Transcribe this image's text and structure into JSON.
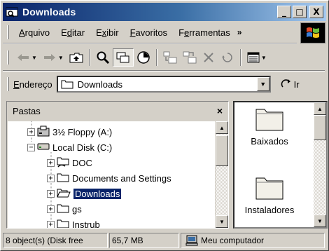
{
  "window": {
    "title": "Downloads",
    "caption_buttons": {
      "minimize": "_",
      "maximize": "□",
      "close": "X"
    }
  },
  "menubar": {
    "items": [
      {
        "label": "Arquivo",
        "accel_index": 0
      },
      {
        "label": "Editar",
        "accel_index": 1
      },
      {
        "label": "Exibir",
        "accel_index": 1
      },
      {
        "label": "Favoritos",
        "accel_index": 0
      },
      {
        "label": "Ferramentas",
        "accel_index": 1
      }
    ],
    "overflow": "»"
  },
  "toolbar": {
    "buttons": [
      {
        "name": "back-icon",
        "dropdown": true
      },
      {
        "name": "forward-icon",
        "dropdown": true
      },
      {
        "name": "up-folder-icon"
      },
      {
        "name": "search-icon"
      },
      {
        "name": "folders-icon",
        "pressed": true
      },
      {
        "name": "history-icon"
      },
      {
        "name": "move-to-icon"
      },
      {
        "name": "copy-to-icon"
      },
      {
        "name": "delete-icon"
      },
      {
        "name": "undo-icon"
      },
      {
        "name": "views-icon",
        "dropdown": true
      }
    ]
  },
  "address": {
    "label": "Endereço",
    "value": "Downloads",
    "go_label": "Ir"
  },
  "folders_pane": {
    "title": "Pastas",
    "close": "×",
    "tree": [
      {
        "label": "3½ Floppy (A:)",
        "icon": "floppy-drive-icon",
        "expander": "+",
        "level": 1
      },
      {
        "label": "Local Disk (C:)",
        "icon": "hard-drive-icon",
        "expander": "−",
        "level": 1
      },
      {
        "label": "DOC",
        "icon": "shared-folder-icon",
        "expander": "+",
        "level": 2
      },
      {
        "label": "Documents and Settings",
        "icon": "folder-icon",
        "expander": "+",
        "level": 2
      },
      {
        "label": "Downloads",
        "icon": "open-folder-icon",
        "expander": "+",
        "level": 2,
        "selected": true
      },
      {
        "label": "gs",
        "icon": "folder-icon",
        "expander": "+",
        "level": 2
      },
      {
        "label": "Instrub",
        "icon": "folder-icon",
        "expander": "+",
        "level": 2
      }
    ]
  },
  "content": {
    "items": [
      {
        "label": "Baixados",
        "icon": "folder-icon"
      },
      {
        "label": "Instaladores",
        "icon": "folder-icon"
      }
    ]
  },
  "statusbar": {
    "objects": "8 object(s) (Disk free",
    "size": "65,7 MB",
    "zone": "Meu computador"
  }
}
